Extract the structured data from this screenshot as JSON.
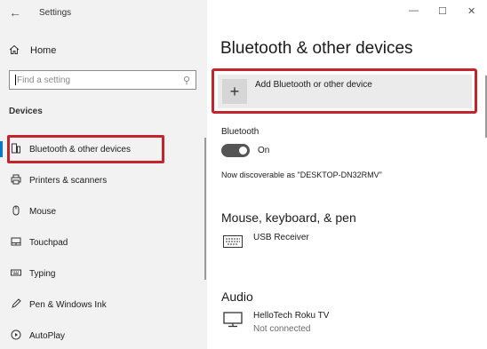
{
  "window": {
    "title": "Settings"
  },
  "sidebar": {
    "home_label": "Home",
    "search_placeholder": "Find a setting",
    "section": "Devices",
    "items": [
      {
        "label": "Bluetooth & other devices",
        "icon": "bluetooth-device-icon",
        "active": true
      },
      {
        "label": "Printers & scanners",
        "icon": "printer-icon"
      },
      {
        "label": "Mouse",
        "icon": "mouse-icon"
      },
      {
        "label": "Touchpad",
        "icon": "touchpad-icon"
      },
      {
        "label": "Typing",
        "icon": "keyboard-icon"
      },
      {
        "label": "Pen & Windows Ink",
        "icon": "pen-icon"
      },
      {
        "label": "AutoPlay",
        "icon": "autoplay-icon"
      }
    ]
  },
  "main": {
    "title": "Bluetooth & other devices",
    "add_device_label": "Add Bluetooth or other device",
    "bluetooth_label": "Bluetooth",
    "bluetooth_state": "On",
    "discoverable_text": "Now discoverable as \"DESKTOP-DN32RMV\"",
    "sections": [
      {
        "title": "Mouse, keyboard, & pen",
        "devices": [
          {
            "name": "USB Receiver",
            "status": "",
            "icon": "keyboard-icon"
          }
        ]
      },
      {
        "title": "Audio",
        "devices": [
          {
            "name": "HelloTech Roku TV",
            "status": "Not connected",
            "icon": "monitor-icon"
          }
        ]
      }
    ]
  },
  "colors": {
    "highlight": "#c4242b",
    "accent": "#0078d4",
    "sidebar_bg": "#f2f2f2"
  }
}
